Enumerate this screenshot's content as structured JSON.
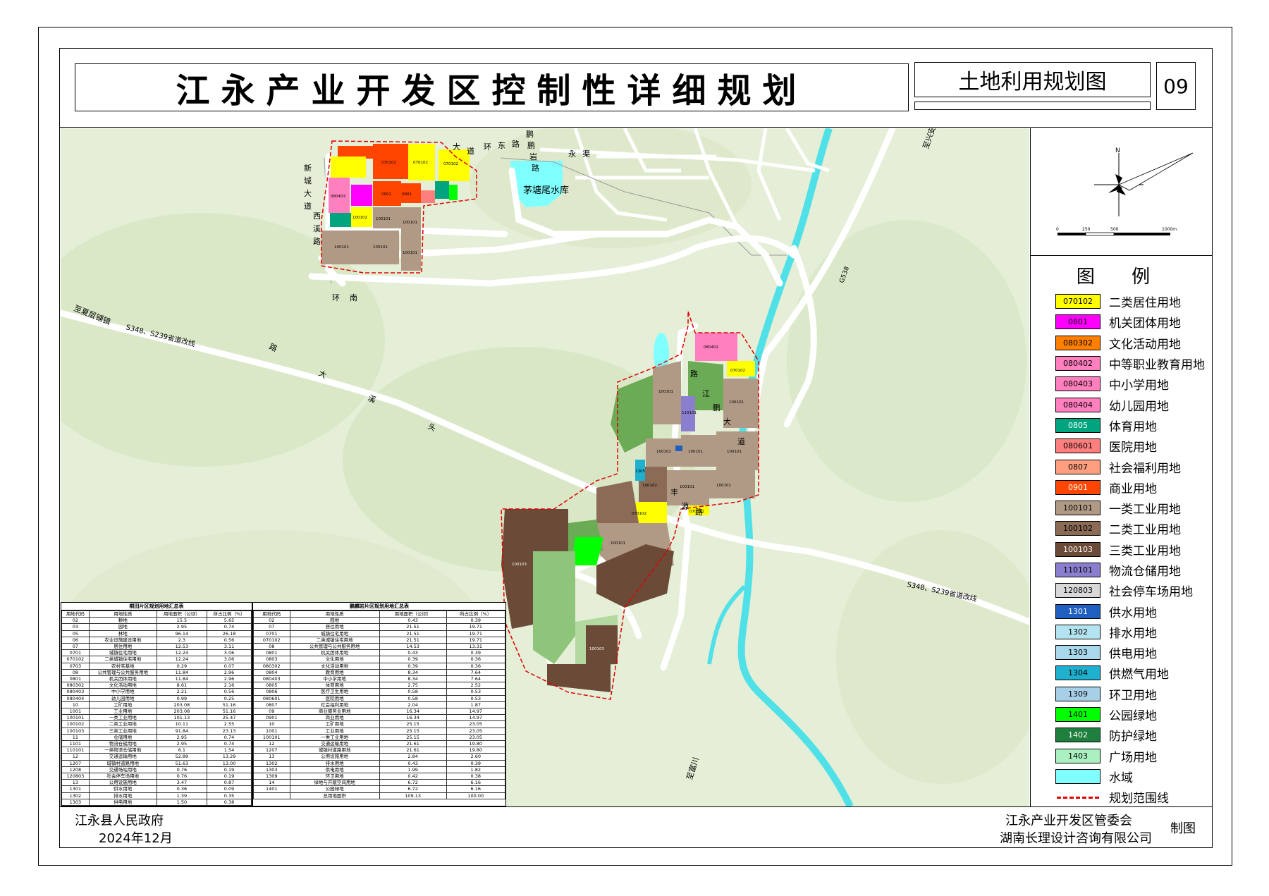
{
  "header": {
    "title": "江永产业开发区控制性详细规划",
    "subtitle": "土地利用规划图",
    "sheet_no": "09"
  },
  "map": {
    "labels": {
      "reservoir": "茅塘尾水库",
      "highway": "S348、S239省道改线",
      "highway2": "S348、S239省道改线",
      "to_town": "至夏层铺镇",
      "to_xingan": "至兴安",
      "to_fuchuan": "至富川",
      "g538": "G538",
      "road_names": [
        "鹏",
        "鹏",
        "岩",
        "路",
        "永",
        "渠",
        "环",
        "东",
        "路",
        "大",
        "道",
        "新",
        "城",
        "大",
        "道",
        "西",
        "溪",
        "路",
        "环",
        "南",
        "路",
        "大",
        "溪",
        "头",
        "路",
        "江",
        "鹏",
        "大",
        "道",
        "丰",
        "源",
        "路"
      ]
    },
    "parcel_codes": {
      "n1": "070102",
      "n2": "0901",
      "n3": "070102",
      "n4": "070102",
      "n5": "080403",
      "n6": "0901",
      "n7": "100101",
      "n8": "100101",
      "n9": "100102",
      "n10": "100101",
      "n11": "100101",
      "n12": "100101",
      "s1": "080402",
      "s2": "070102",
      "s3": "100101",
      "s4": "100101",
      "s5": "100101",
      "s6": "110101",
      "s7": "100101",
      "s8": "100101",
      "s9": "100101",
      "s10": "070102",
      "s11": "070102",
      "s12": "100102",
      "s13": "100103",
      "s14": "100101",
      "s15": "100101",
      "s16": "100103",
      "s17": "1305"
    }
  },
  "compass": {
    "north": "N",
    "scale_ticks": [
      "0",
      "250",
      "500",
      "1000m"
    ]
  },
  "legend": {
    "title": "图 例",
    "items": [
      {
        "code": "070102",
        "label": "二类居住用地",
        "color": "#ffff00",
        "text_color": "#000"
      },
      {
        "code": "0801",
        "label": "机关团体用地",
        "color": "#ff00ff",
        "text_color": "#000"
      },
      {
        "code": "080302",
        "label": "文化活动用地",
        "color": "#ff7f00",
        "text_color": "#000"
      },
      {
        "code": "080402",
        "label": "中等职业教育用地",
        "color": "#ff7fbf",
        "text_color": "#000"
      },
      {
        "code": "080403",
        "label": "中小学用地",
        "color": "#ff7fbf",
        "text_color": "#000"
      },
      {
        "code": "080404",
        "label": "幼儿园用地",
        "color": "#ff7fbf",
        "text_color": "#000"
      },
      {
        "code": "0805",
        "label": "体育用地",
        "color": "#00a57f",
        "text_color": "#fff"
      },
      {
        "code": "080601",
        "label": "医院用地",
        "color": "#ff7f7f",
        "text_color": "#000"
      },
      {
        "code": "0807",
        "label": "社会福利用地",
        "color": "#ff9f7f",
        "text_color": "#000"
      },
      {
        "code": "0901",
        "label": "商业用地",
        "color": "#ff4500",
        "text_color": "#fff"
      },
      {
        "code": "100101",
        "label": "一类工业用地",
        "color": "#b19a85",
        "text_color": "#000"
      },
      {
        "code": "100102",
        "label": "二类工业用地",
        "color": "#8b6b55",
        "text_color": "#000"
      },
      {
        "code": "100103",
        "label": "三类工业用地",
        "color": "#6b4a38",
        "text_color": "#fff"
      },
      {
        "code": "110101",
        "label": "物流仓储用地",
        "color": "#8a7fcf",
        "text_color": "#000"
      },
      {
        "code": "120803",
        "label": "社会停车场用地",
        "color": "#d8d8d8",
        "text_color": "#000"
      },
      {
        "code": "1301",
        "label": "供水用地",
        "color": "#1f5fbf",
        "text_color": "#fff"
      },
      {
        "code": "1302",
        "label": "排水用地",
        "color": "#b3e3f0",
        "text_color": "#000"
      },
      {
        "code": "1303",
        "label": "供电用地",
        "color": "#a8d8ea",
        "text_color": "#000"
      },
      {
        "code": "1304",
        "label": "供燃气用地",
        "color": "#1fb0cf",
        "text_color": "#000"
      },
      {
        "code": "1309",
        "label": "环卫用地",
        "color": "#a8cfe8",
        "text_color": "#000"
      },
      {
        "code": "1401",
        "label": "公园绿地",
        "color": "#00ff00",
        "text_color": "#000"
      },
      {
        "code": "1402",
        "label": "防护绿地",
        "color": "#1f7f3f",
        "text_color": "#fff"
      },
      {
        "code": "1403",
        "label": "广场用地",
        "color": "#aaf0c0",
        "text_color": "#000"
      },
      {
        "code": "",
        "label": "水域",
        "color": "#80ffff",
        "text_color": "#000"
      },
      {
        "code": "",
        "label": "规划范围线",
        "color": "",
        "text_color": "#000"
      }
    ]
  },
  "table1": {
    "title": "桐田片区规划用地汇总表",
    "headers": [
      "用地代码",
      "用地性质",
      "用地面积（公顷）",
      "所占比例（%）"
    ],
    "rows": [
      [
        "02",
        "耕地",
        "15.5",
        "5.65"
      ],
      [
        "03",
        "园地",
        "2.95",
        "0.74"
      ],
      [
        "05",
        "林地",
        "96.14",
        "26.18"
      ],
      [
        "06",
        "农业设施建设用地",
        "2.3",
        "0.56"
      ],
      [
        "07",
        "居住用地",
        "12.53",
        "3.11"
      ],
      [
        "0701",
        "城镇住宅用地",
        "12.24",
        "3.06"
      ],
      [
        "070102",
        "二类城镇住宅用地",
        "12.24",
        "3.06"
      ],
      [
        "0703",
        "农村宅基地",
        "0.29",
        "0.07"
      ],
      [
        "08",
        "公共管理与公共服务用地",
        "11.84",
        "2.96"
      ],
      [
        "0801",
        "机关团体用地",
        "11.84",
        "2.96"
      ],
      [
        "080302",
        "文化活动用地",
        "8.61",
        "2.16"
      ],
      [
        "080403",
        "中小学用地",
        "2.21",
        "0.56"
      ],
      [
        "080404",
        "幼儿园用地",
        "0.99",
        "0.25"
      ],
      [
        "10",
        "工矿用地",
        "203.08",
        "51.16"
      ],
      [
        "1001",
        "工业用地",
        "203.08",
        "51.16"
      ],
      [
        "100101",
        "一类工业用地",
        "101.13",
        "25.47"
      ],
      [
        "100102",
        "二类工业用地",
        "10.11",
        "2.55"
      ],
      [
        "100103",
        "三类工业用地",
        "91.84",
        "23.13"
      ],
      [
        "11",
        "仓储用地",
        "2.95",
        "0.74"
      ],
      [
        "1101",
        "物流仓储用地",
        "2.95",
        "0.74"
      ],
      [
        "110101",
        "一类物流仓储用地",
        "6.1",
        "1.54"
      ],
      [
        "12",
        "交通运输用地",
        "52.89",
        "13.29"
      ],
      [
        "1207",
        "城镇村道路用地",
        "51.63",
        "13.00"
      ],
      [
        "1208",
        "交通场站用地",
        "0.76",
        "0.19"
      ],
      [
        "120803",
        "社会停车场用地",
        "0.76",
        "0.19"
      ],
      [
        "13",
        "公用设施用地",
        "3.47",
        "0.87"
      ],
      [
        "1301",
        "供水用地",
        "0.36",
        "0.09"
      ],
      [
        "1302",
        "排水用地",
        "1.39",
        "0.35"
      ],
      [
        "1303",
        "供电用地",
        "1.50",
        "0.38"
      ],
      [
        "1309",
        "环卫用地",
        "0.26",
        "0.07"
      ],
      [
        "14",
        "绿地与开敞空间用地",
        "10.33",
        "2.60"
      ],
      [
        "1401",
        "公园绿地",
        "8.56",
        "2.16"
      ],
      [
        "1402",
        "防护绿地",
        "1.55",
        "0.39"
      ],
      [
        "1403",
        "广场用地",
        "0.26",
        "0.07"
      ],
      [
        "17",
        "陆地水域",
        "0.41",
        "0.10"
      ],
      [
        "1704",
        "坑塘水面",
        "0.12",
        "0.03"
      ],
      [
        "1705",
        "沟渠",
        "0.29",
        "0.07"
      ],
      [
        "",
        "总用地面积",
        "397.1",
        "100.00"
      ]
    ]
  },
  "table2": {
    "title": "鹏麟岩片区规划用地汇总表",
    "headers": [
      "用地代码",
      "用地性质",
      "用地面积（公顷）",
      "所占比例（%）"
    ],
    "rows": [
      [
        "02",
        "园地",
        "0.43",
        "0.39"
      ],
      [
        "07",
        "居住用地",
        "21.51",
        "19.71"
      ],
      [
        "0701",
        "城镇住宅用地",
        "21.51",
        "19.71"
      ],
      [
        "070102",
        "二类城镇住宅用地",
        "21.51",
        "19.71"
      ],
      [
        "08",
        "公共管理与公共服务用地",
        "14.53",
        "13.31"
      ],
      [
        "0801",
        "机关团体用地",
        "0.43",
        "0.39"
      ],
      [
        "0803",
        "文化用地",
        "0.39",
        "0.36"
      ],
      [
        "080302",
        "文化活动用地",
        "0.39",
        "0.36"
      ],
      [
        "0804",
        "教育用地",
        "8.34",
        "7.64"
      ],
      [
        "080403",
        "中小学用地",
        "8.34",
        "7.64"
      ],
      [
        "0805",
        "体育用地",
        "2.75",
        "2.52"
      ],
      [
        "0806",
        "医疗卫生用地",
        "0.58",
        "0.53"
      ],
      [
        "080601",
        "医院用地",
        "0.58",
        "0.53"
      ],
      [
        "0807",
        "社会福利用地",
        "2.04",
        "1.87"
      ],
      [
        "09",
        "商业服务业用地",
        "16.34",
        "14.97"
      ],
      [
        "0901",
        "商业用地",
        "16.34",
        "14.97"
      ],
      [
        "10",
        "工矿用地",
        "25.15",
        "23.05"
      ],
      [
        "1001",
        "工业用地",
        "25.15",
        "23.05"
      ],
      [
        "100101",
        "一类工业用地",
        "25.15",
        "23.05"
      ],
      [
        "12",
        "交通运输用地",
        "21.61",
        "19.80"
      ],
      [
        "1207",
        "城镇村道路用地",
        "21.61",
        "19.80"
      ],
      [
        "13",
        "公用设施用地",
        "2.84",
        "2.60"
      ],
      [
        "1302",
        "排水用地",
        "0.43",
        "0.39"
      ],
      [
        "1303",
        "供电用地",
        "1.99",
        "1.82"
      ],
      [
        "1309",
        "环卫用地",
        "0.42",
        "0.38"
      ],
      [
        "14",
        "绿地与开敞空间用地",
        "6.72",
        "6.16"
      ],
      [
        "1401",
        "公园绿地",
        "6.72",
        "6.16"
      ],
      [
        "",
        "总用地面积",
        "109.13",
        "100.00"
      ]
    ]
  },
  "footer": {
    "left_org": "江永县人民政府",
    "left_date": "2024年12月",
    "right_org1": "江永产业开发区管委会",
    "right_org2": "湖南长理设计咨询有限公司",
    "zhitu": "制图"
  }
}
